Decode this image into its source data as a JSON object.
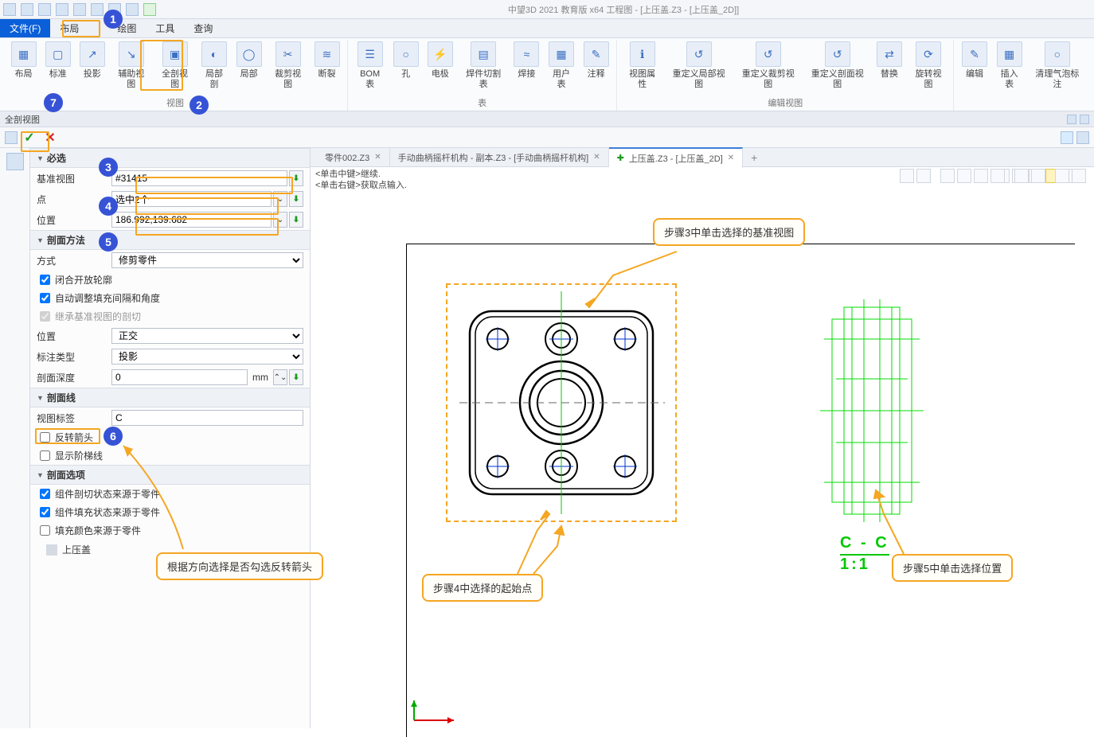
{
  "title": "中望3D 2021 教育版 x64    工程图 - [上压盖.Z3 - [上压盖_2D]]",
  "menu": {
    "file": "文件(F)",
    "layout": "布局",
    "draw": "绘图",
    "tools": "工具",
    "query": "查询"
  },
  "ribbon": {
    "g1": {
      "b1": "布局",
      "b2": "标准",
      "b3": "投影",
      "b4": "辅助视图",
      "b5": "全剖视图",
      "b6": "局部剖",
      "b7": "局部",
      "b8": "裁剪视图",
      "b9": "断裂",
      "label": "视图"
    },
    "g2": {
      "b1": "BOM表",
      "b2": "孔",
      "b3": "电极",
      "b4": "焊件切割表",
      "b5": "焊接",
      "b6": "用户表",
      "b7": "注释",
      "label": "表"
    },
    "g3": {
      "b1": "视图属性",
      "b2": "重定义局部视图",
      "b3": "重定义裁剪视图",
      "b4": "重定义剖面视图",
      "b5": "替换",
      "b6": "旋转视图",
      "label": "编辑视图"
    },
    "g4": {
      "b1": "编辑",
      "b2": "插入表",
      "b3": "清理气泡标注",
      "label": ""
    }
  },
  "panel": {
    "title": "全剖视图"
  },
  "sect": {
    "required": "必选",
    "base_label": "基准视图",
    "base_val": "#31415",
    "point_label": "点",
    "point_val": "选中2个",
    "pos_label": "位置",
    "pos_val": "186.992,139.682",
    "method": "剖面方法",
    "mode_label": "方式",
    "mode_val": "修剪零件",
    "close_loop": "闭合开放轮廓",
    "auto_adjust": "自动调整填充间隔和角度",
    "inherit": "继承基准视图的剖切",
    "pos2_label": "位置",
    "pos2_val": "正交",
    "dim_label": "标注类型",
    "dim_val": "投影",
    "depth_label": "剖面深度",
    "depth_val": "0",
    "depth_unit": "mm",
    "line": "剖面线",
    "tag_label": "视图标签",
    "tag_val": "C",
    "reverse": "反转箭头",
    "step": "显示阶梯线",
    "options": "剖面选项",
    "opt1": "组件剖切状态来源于零件",
    "opt2": "组件填充状态来源于零件",
    "opt3": "填充颜色来源于零件",
    "tree_item": "上压盖"
  },
  "tabs": {
    "t1": "零件002.Z3",
    "t2": "手动曲柄摇杆机构 - 副本.Z3 - [手动曲柄摇杆机构]",
    "t3": "上压盖.Z3 - [上压盖_2D]"
  },
  "prompt": {
    "l1": "<单击中键>继续.",
    "l2": "<单击右键>获取点输入."
  },
  "callouts": {
    "c1": "步骤3中单击选择的基准视图",
    "c2": "步骤4中选择的起始点",
    "c3": "步骤5中单击选择位置",
    "c4": "根据方向选择是否勾选反转箭头"
  },
  "cc_label": "C - C",
  "cc_scale": "1:1"
}
